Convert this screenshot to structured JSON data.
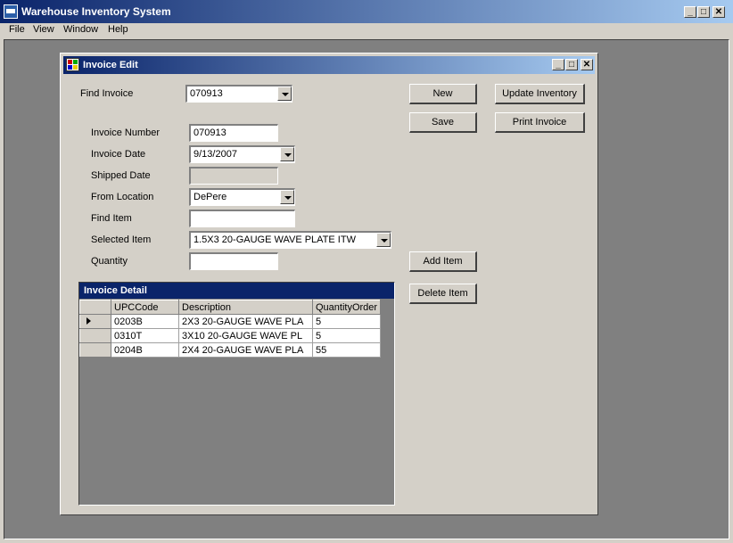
{
  "app": {
    "title": "Warehouse Inventory System",
    "caption_buttons": {
      "minimize": "_",
      "maximize": "□",
      "close": "✕"
    }
  },
  "menu": {
    "items": [
      "File",
      "View",
      "Window",
      "Help"
    ]
  },
  "child_window": {
    "title": "Invoice Edit",
    "caption_buttons": {
      "minimize": "_",
      "maximize": "□",
      "close": "✕"
    }
  },
  "form": {
    "find_invoice": {
      "label": "Find Invoice",
      "value": "070913"
    },
    "invoice_number": {
      "label": "Invoice Number",
      "value": "070913"
    },
    "invoice_date": {
      "label": "Invoice Date",
      "value": "9/13/2007"
    },
    "shipped_date": {
      "label": "Shipped Date",
      "value": ""
    },
    "from_location": {
      "label": "From Location",
      "value": "DePere"
    },
    "find_item": {
      "label": "Find Item",
      "value": ""
    },
    "selected_item": {
      "label": "Selected Item",
      "value": "1.5X3 20-GAUGE WAVE PLATE ITW"
    },
    "quantity": {
      "label": "Quantity",
      "value": ""
    }
  },
  "buttons": {
    "new": "New",
    "update_inventory": "Update Inventory",
    "save": "Save",
    "print_invoice": "Print Invoice",
    "add_item": "Add Item",
    "delete_item": "Delete Item"
  },
  "grid": {
    "caption": "Invoice Detail",
    "columns": [
      "UPCCode",
      "Description",
      "QuantityOrder"
    ],
    "rows": [
      {
        "upc": "0203B",
        "description": "2X3 20-GAUGE WAVE PLA",
        "qty": "5",
        "current": true
      },
      {
        "upc": "0310T",
        "description": "3X10 20-GAUGE WAVE PL",
        "qty": "5",
        "current": false
      },
      {
        "upc": "0204B",
        "description": "2X4 20-GAUGE WAVE PLA",
        "qty": "55",
        "current": false
      }
    ]
  },
  "colors": {
    "title_active": "#0a246a",
    "title_gradient_end": "#a6caf0",
    "face": "#d4d0c8",
    "mdi_background": "#808080"
  }
}
